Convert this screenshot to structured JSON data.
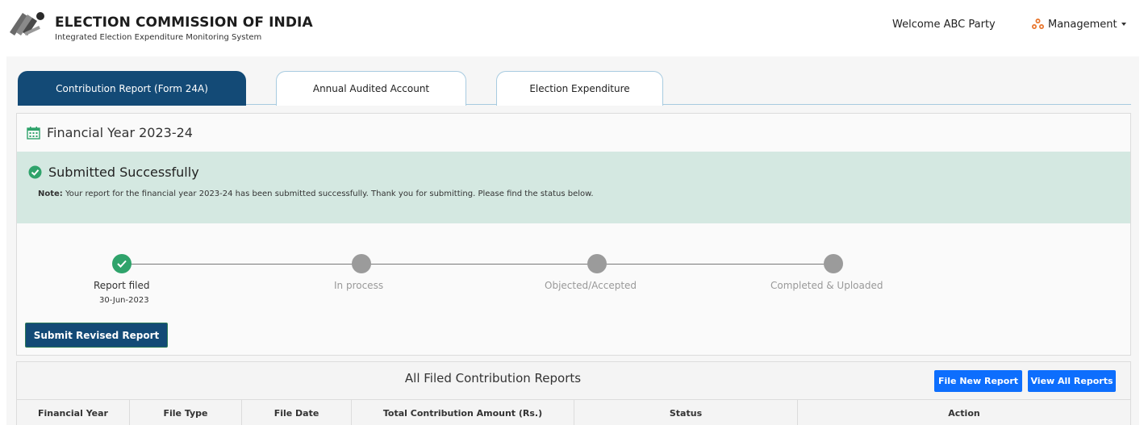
{
  "header": {
    "title": "ELECTION COMMISSION OF INDIA",
    "subtitle": "Integrated Election Expenditure Monitoring System",
    "welcome": "Welcome ABC Party",
    "menu_label": "Management"
  },
  "tabs": [
    {
      "label": "Contribution Report (Form 24A)",
      "active": true
    },
    {
      "label": "Annual Audited Account",
      "active": false
    },
    {
      "label": "Election Expenditure",
      "active": false
    }
  ],
  "financial_year": {
    "heading": "Financial Year 2023-24"
  },
  "status_banner": {
    "title": "Submitted Successfully",
    "note_label": "Note:",
    "note_text": "Your report for the financial year 2023-24 has been submitted successfully. Thank you for submitting. Please find the status below."
  },
  "stepper": {
    "steps": [
      {
        "label": "Report filed",
        "date": "30-Jun-2023",
        "done": true
      },
      {
        "label": "In process",
        "done": false
      },
      {
        "label": "Objected/Accepted",
        "done": false
      },
      {
        "label": "Completed & Uploaded",
        "done": false
      }
    ]
  },
  "actions": {
    "submit_revised": "Submit Revised Report"
  },
  "reports": {
    "title": "All Filed Contribution Reports",
    "file_new": "File New Report",
    "view_all": "View All Reports",
    "columns": [
      "Financial Year",
      "File Type",
      "File Date",
      "Total Contribution Amount (Rs.)",
      "Status",
      "Action"
    ]
  },
  "colors": {
    "primary_navy": "#134a76",
    "success_bg": "#d4e8e1",
    "success_green": "#2fa36b",
    "accent_blue": "#0d6efd"
  }
}
